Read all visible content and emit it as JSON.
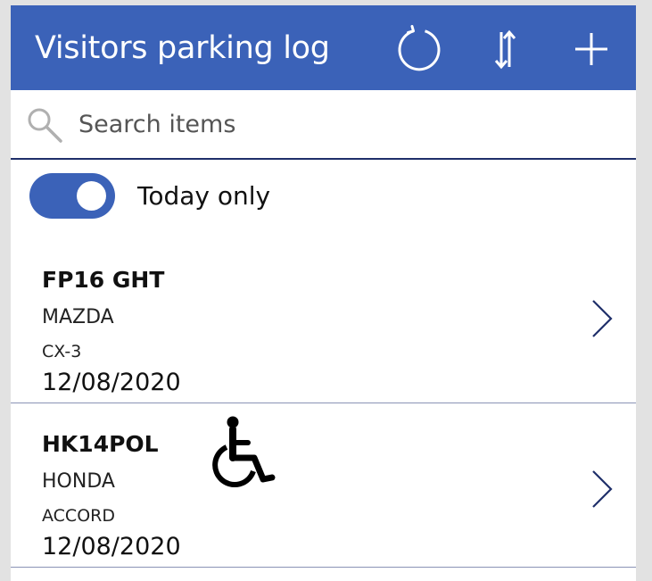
{
  "header": {
    "title": "Visitors parking log",
    "refresh_icon": "refresh-icon",
    "sort_icon": "sort-icon",
    "add_icon": "add-icon",
    "background_color": "#3b62b8"
  },
  "search": {
    "placeholder": "Search items",
    "value": "",
    "icon": "search-icon"
  },
  "filter": {
    "toggle_on": true,
    "label": "Today only"
  },
  "items": [
    {
      "plate": "FP16 GHT",
      "make": "MAZDA",
      "model": "CX-3",
      "date": "12/08/2020",
      "accessible": false
    },
    {
      "plate": "HK14POL",
      "make": "HONDA",
      "model": "ACCORD",
      "date": "12/08/2020",
      "accessible": true,
      "accessible_icon": "wheelchair-icon"
    }
  ]
}
